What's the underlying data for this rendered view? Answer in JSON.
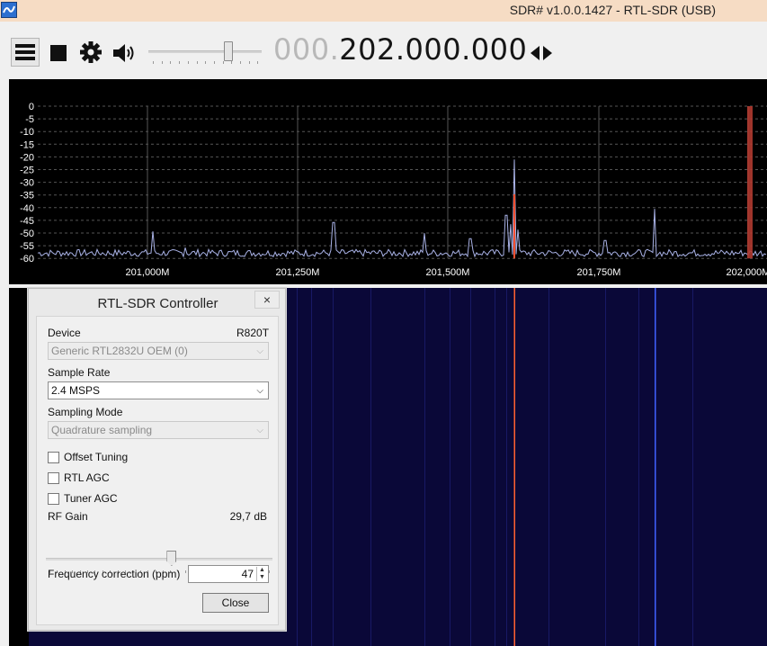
{
  "window": {
    "title": "SDR# v1.0.0.1427 - RTL-SDR (USB)",
    "app_icon": "sdr-app-icon"
  },
  "toolbar": {
    "menu_icon": "hamburger-menu-icon",
    "stop_icon": "stop-icon",
    "settings_icon": "gear-icon",
    "audio_icon": "speaker-icon",
    "volume_level": 0.72,
    "frequency_prefix": "000.",
    "frequency_main": "202.000.000",
    "tuning_icon": "left-right-arrows-icon"
  },
  "spectrum": {
    "y_ticks": [
      "0",
      "-5",
      "-10",
      "-15",
      "-20",
      "-25",
      "-30",
      "-35",
      "-40",
      "-45",
      "-50",
      "-55",
      "-60"
    ],
    "x_ticks": [
      "201,000M",
      "201,250M",
      "201,500M",
      "201,750M",
      "202,000M"
    ],
    "colors": {
      "background": "#000000",
      "trace": "#a9b2e6",
      "grid": "#555555",
      "marker": "#ff5030"
    }
  },
  "waterfall": {
    "colors": {
      "background": "#0a0838",
      "carrier": "#ff6030",
      "line": "#4060ff"
    }
  },
  "dialog": {
    "title": "RTL-SDR Controller",
    "close_x": "×",
    "device_label": "Device",
    "device_tuner": "R820T",
    "device_value": "Generic RTL2832U OEM (0)",
    "sample_rate_label": "Sample Rate",
    "sample_rate_value": "2.4 MSPS",
    "sampling_mode_label": "Sampling Mode",
    "sampling_mode_value": "Quadrature sampling",
    "offset_tuning_label": "Offset Tuning",
    "rtl_agc_label": "RTL AGC",
    "tuner_agc_label": "Tuner AGC",
    "rf_gain_label": "RF Gain",
    "rf_gain_value": "29,7 dB",
    "rf_gain_level": 0.56,
    "freq_correction_label": "Frequency correction (ppm)",
    "freq_correction_value": "47",
    "close_button": "Close",
    "spin_up": "▲",
    "spin_down": "▼",
    "dropdown_arrow": "⌵"
  }
}
